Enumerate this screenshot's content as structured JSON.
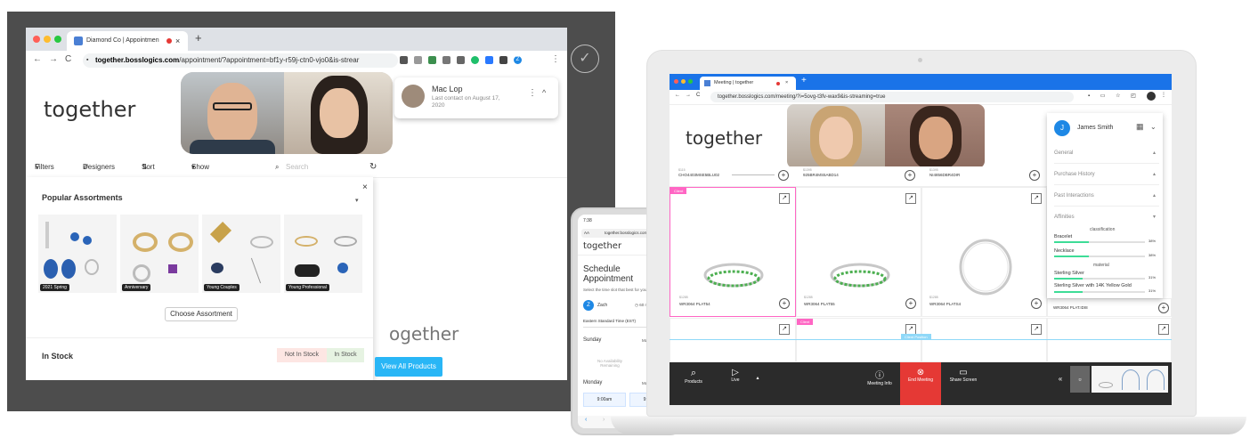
{
  "desktop": {
    "tab_title": "Diamond Co | Appointmen",
    "new_tab": "+",
    "close_tab": "×",
    "url_host": "together.bosslogics.com",
    "url_path": "/appointment/?appointment=bf1y-r59j-ctn0-vjo0&is-strear",
    "logo": "together",
    "user_card": {
      "name": "Mac Lop",
      "last_contact": "Last contact on August 17, 2020",
      "menu": "⋮",
      "collapse": "^"
    },
    "toolbar": {
      "filters": "Filters",
      "designers": "Designers",
      "sort": "Sort By",
      "show": "Show 50 records",
      "search_placeholder": "Search"
    },
    "popular": {
      "title": "Popular Assortments",
      "close": "×",
      "tiles": [
        "2021 Spring",
        "Anniversary",
        "Young Couples",
        "Young Professional"
      ],
      "choose_button": "Choose Assortment"
    },
    "in_stock": {
      "title": "In Stock",
      "not_in_stock": "Not In Stock",
      "in_stock": "In Stock"
    },
    "bg_logo": "ogether",
    "view_all": "View All Products"
  },
  "phone": {
    "time": "7:38",
    "aa": "AA",
    "url": "together.bosslogics.com",
    "logo": "together",
    "heading_1": "Schedule",
    "heading_2": "Appointment",
    "subtitle": "Select the time slot that best for you",
    "user_initial": "Z",
    "user_name": "Zach",
    "duration": "60 minutes",
    "timezone": "Eastern Standard Time (EST)",
    "day1": "Sunday",
    "day1_date": "May 3 2020",
    "no_availability": "No Availability Remaining",
    "day2": "Monday",
    "day2_date": "May 4 2020",
    "slot1": "9:00am",
    "slot2": "9:30am"
  },
  "laptop": {
    "tab_title": "Meeting | together",
    "new_tab": "+",
    "close_tab": "×",
    "url": "together.bosslogics.com/meeting/?i=5ovg-t3fv-wax9&is-streaming=true",
    "logo": "together",
    "top_skus": [
      "CHO4403MSE5BLU02",
      "925BR4MS5ABD14",
      "NI4856DBR4DIR"
    ],
    "top_prices": [
      "$115",
      "$1395",
      "$1395"
    ],
    "main_skus": [
      "WR3064 PLAT54",
      "WR3064 PLAT55",
      "WR3064 PLATS4",
      "WR3064 PLAT.IDI8"
    ],
    "main_prices": [
      "$1285",
      "$1285",
      "$1285",
      "$1285"
    ],
    "client_badge": "Client",
    "client_badge2": "Client",
    "client_position": "Client Position",
    "sidebar": {
      "initial": "J",
      "name": "James Smith",
      "general": "General",
      "purchase_history": "Purchase History",
      "past_interactions": "Past Interactions",
      "affinities": "Affinities",
      "classification": "classification",
      "bracelet": "Bracelet",
      "bracelet_pct": "38%",
      "necklace": "Necklace",
      "necklace_pct": "38%",
      "material": "material",
      "silver": "Sterling Silver",
      "silver_pct": "31%",
      "silver_gold": "Sterling Silver with 14K Yellow Gold",
      "silver_gold_pct": "31%"
    },
    "controls": {
      "products": "Products",
      "live": "Live",
      "meeting_info": "Meeting Info",
      "end_meeting": "End Meeting",
      "share_screen": "Share Screen",
      "collapse": "«"
    }
  },
  "affinity_levels": {
    "bracelet": 0.38,
    "necklace": 0.38,
    "sterling_silver": 0.31,
    "silver_gold": 0.31
  },
  "colors": {
    "accent_blue": "#29b6f6",
    "chrome_blue": "#1a73e8",
    "end_red": "#e53935",
    "affinity_green": "#3ddc97",
    "client_pink": "#ff4fa3"
  }
}
